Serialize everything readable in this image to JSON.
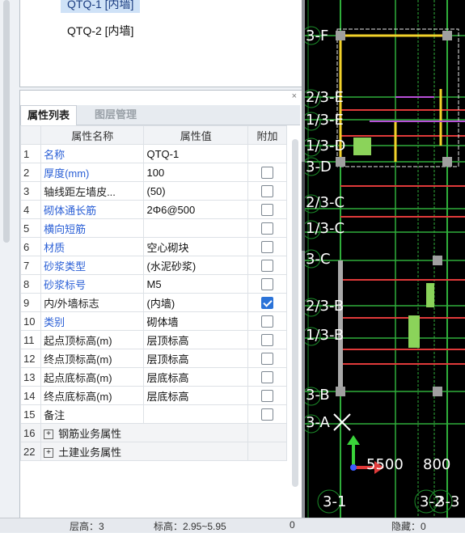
{
  "component_list": {
    "items": [
      {
        "label": "QTQ-1 [内墙]",
        "selected": true
      },
      {
        "label": "QTQ-2 [内墙]",
        "selected": false
      }
    ]
  },
  "prop_panel": {
    "close_icon": "×",
    "tabs": [
      {
        "label": "属性列表",
        "active": true
      },
      {
        "label": "图层管理",
        "active": false
      }
    ],
    "columns": {
      "name": "属性名称",
      "value": "属性值",
      "extra": "附加"
    },
    "rows": [
      {
        "idx": "1",
        "name": "名称",
        "value": "QTQ-1",
        "highlight": true,
        "checkbox": false,
        "checked": false
      },
      {
        "idx": "2",
        "name": "厚度(mm)",
        "value": "100",
        "highlight": true,
        "checkbox": true,
        "checked": false
      },
      {
        "idx": "3",
        "name": "轴线距左墙皮...",
        "value": "(50)",
        "highlight": false,
        "checkbox": true,
        "checked": false
      },
      {
        "idx": "4",
        "name": "砌体通长筋",
        "value": "2Φ6@500",
        "highlight": true,
        "checkbox": true,
        "checked": false
      },
      {
        "idx": "5",
        "name": "横向短筋",
        "value": "",
        "highlight": true,
        "checkbox": true,
        "checked": false
      },
      {
        "idx": "6",
        "name": "材质",
        "value": "空心砌块",
        "highlight": true,
        "checkbox": true,
        "checked": false
      },
      {
        "idx": "7",
        "name": "砂浆类型",
        "value": "(水泥砂浆)",
        "highlight": true,
        "checkbox": true,
        "checked": false
      },
      {
        "idx": "8",
        "name": "砂浆标号",
        "value": "M5",
        "highlight": true,
        "checkbox": true,
        "checked": false
      },
      {
        "idx": "9",
        "name": "内/外墙标志",
        "value": "(内墙)",
        "highlight": false,
        "checkbox": true,
        "checked": true
      },
      {
        "idx": "10",
        "name": "类别",
        "value": "砌体墙",
        "highlight": true,
        "checkbox": true,
        "checked": false
      },
      {
        "idx": "11",
        "name": "起点顶标高(m)",
        "value": "层顶标高",
        "highlight": false,
        "checkbox": true,
        "checked": false
      },
      {
        "idx": "12",
        "name": "终点顶标高(m)",
        "value": "层顶标高",
        "highlight": false,
        "checkbox": true,
        "checked": false
      },
      {
        "idx": "13",
        "name": "起点底标高(m)",
        "value": "层底标高",
        "highlight": false,
        "checkbox": true,
        "checked": false
      },
      {
        "idx": "14",
        "name": "终点底标高(m)",
        "value": "层底标高",
        "highlight": false,
        "checkbox": true,
        "checked": false
      },
      {
        "idx": "15",
        "name": "备注",
        "value": "",
        "highlight": false,
        "checkbox": true,
        "checked": false
      }
    ],
    "groups": [
      {
        "idx": "16",
        "expand": "+",
        "name": "钢筋业务属性"
      },
      {
        "idx": "22",
        "expand": "+",
        "name": "土建业务属性"
      }
    ]
  },
  "cad": {
    "axis_labels": [
      "3-F",
      "2/3-E",
      "1/3-E",
      "1/3-D",
      "3-D",
      "2/3-C",
      "1/3-C",
      "3-C",
      "2/3-B",
      "1/3-B",
      "3-B",
      "3-A"
    ],
    "bottom_labels": [
      "3-1",
      "3-2",
      "3-3"
    ],
    "dims": [
      "5500",
      "800"
    ]
  },
  "status": {
    "floor": "层高：3",
    "elev": "标高：2.95~5.95",
    "zero": "0",
    "hidden": "隐藏：0"
  }
}
